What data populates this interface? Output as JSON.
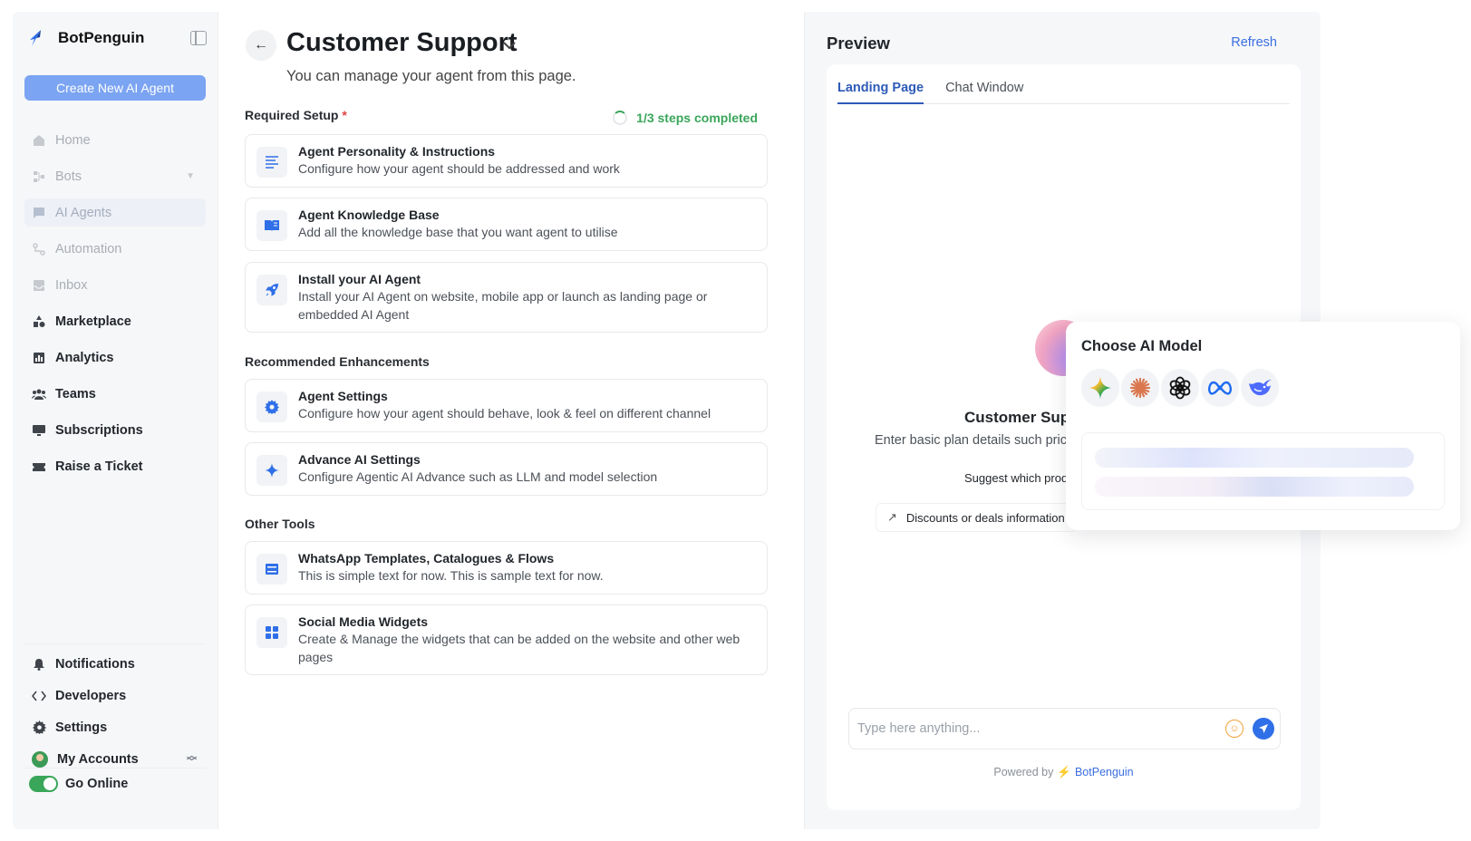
{
  "brand": {
    "name": "BotPenguin"
  },
  "sidebar": {
    "create_label": "Create New AI Agent",
    "items": [
      {
        "label": "Home",
        "icon": "home-icon"
      },
      {
        "label": "Bots",
        "icon": "bots-icon"
      },
      {
        "label": "AI Agents",
        "icon": "chat-icon"
      },
      {
        "label": "Automation",
        "icon": "automation-icon"
      },
      {
        "label": "Inbox",
        "icon": "inbox-icon"
      },
      {
        "label": "Marketplace",
        "icon": "shapes-icon"
      },
      {
        "label": "Analytics",
        "icon": "chart-icon"
      },
      {
        "label": "Teams",
        "icon": "team-icon"
      },
      {
        "label": "Subscriptions",
        "icon": "monitor-icon"
      },
      {
        "label": "Raise a Ticket",
        "icon": "ticket-icon"
      }
    ],
    "bottom": [
      {
        "label": "Notifications",
        "icon": "bell-icon"
      },
      {
        "label": "Developers",
        "icon": "code-icon"
      },
      {
        "label": "Settings",
        "icon": "gear-icon"
      },
      {
        "label": "My Accounts",
        "icon": "avatar"
      }
    ],
    "online_label": "Go Online"
  },
  "main": {
    "title": "Customer Support",
    "subtitle": "You can manage your agent from this page.",
    "required_label": "Required Setup",
    "required_star": "*",
    "steps": "1/3 steps completed",
    "required": [
      {
        "title": "Agent Personality & Instructions",
        "desc": "Configure how your agent should be addressed and work"
      },
      {
        "title": "Agent Knowledge Base",
        "desc": "Add all the knowledge base that you want agent to utilise"
      },
      {
        "title": "Install your AI Agent",
        "desc": "Install your AI Agent on website, mobile app or launch as landing page or embedded AI Agent"
      }
    ],
    "recommended_label": "Recommended Enhancements",
    "recommended": [
      {
        "title": "Agent Settings",
        "desc": "Configure how your agent should behave, look & feel on different channel"
      },
      {
        "title": "Advance AI Settings",
        "desc": "Configure Agentic AI Advance such as LLM and model selection"
      }
    ],
    "other_label": "Other Tools",
    "other": [
      {
        "title": "WhatsApp Templates, Catalogues & Flows",
        "desc": "This is simple text for now. This is sample text for now."
      },
      {
        "title": "Social Media Widgets",
        "desc": "Create & Manage the widgets that can be added on the website and other web pages"
      }
    ]
  },
  "preview": {
    "title": "Preview",
    "refresh": "Refresh",
    "tabs": [
      "Landing Page",
      "Chat Window"
    ],
    "bot_name": "Customer Suppo",
    "bot_desc": "Enter basic plan details such pricin",
    "suggestions": [
      "Suggest which product",
      "Discounts or deals information"
    ],
    "input_placeholder": "Type here anything...",
    "powered_by": "Powered by",
    "powered_brand": "BotPenguin"
  },
  "popup": {
    "title": "Choose AI Model",
    "models": [
      "gemini-icon",
      "claude-icon",
      "openai-icon",
      "meta-icon",
      "deepseek-icon"
    ]
  },
  "colors": {
    "accent": "#2e5ab8",
    "create_button": "#7ba4f2",
    "success": "#3aa65a",
    "link": "#3b6ee0"
  }
}
